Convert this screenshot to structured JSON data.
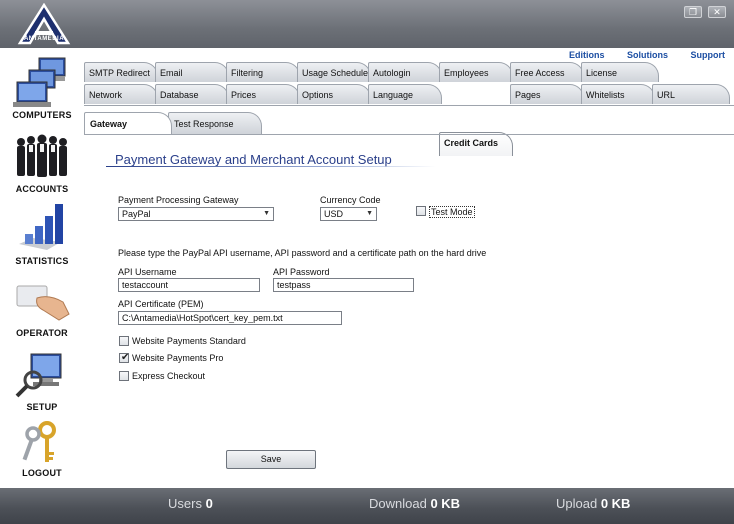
{
  "app": {
    "logo_text": "ANTAMEDIA",
    "restore_label": "❐",
    "close_label": "✕"
  },
  "top_links": [
    "Editions",
    "Solutions",
    "Support"
  ],
  "sidebar": {
    "items": [
      {
        "label": "COMPUTERS",
        "icon": "computers-icon"
      },
      {
        "label": "ACCOUNTS",
        "icon": "accounts-icon"
      },
      {
        "label": "STATISTICS",
        "icon": "statistics-icon"
      },
      {
        "label": "OPERATOR",
        "icon": "operator-icon"
      },
      {
        "label": "SETUP",
        "icon": "setup-icon"
      },
      {
        "label": "LOGOUT",
        "icon": "logout-icon"
      }
    ]
  },
  "tabs_row1": [
    "SMTP Redirect",
    "Email",
    "Filtering",
    "Usage Schedule",
    "Autologin",
    "Employees",
    "Free Access",
    "License"
  ],
  "tabs_row2": [
    "Network",
    "Database",
    "Prices",
    "Options",
    "Language",
    "Credit Cards",
    "Pages",
    "Whitelists",
    "URL"
  ],
  "active_tab": "Credit Cards",
  "subtabs": [
    "Gateway",
    "Test Response"
  ],
  "active_subtab": "Gateway",
  "form": {
    "title": "Payment Gateway and Merchant Account Setup",
    "gateway_label": "Payment Processing Gateway",
    "gateway_value": "PayPal",
    "currency_label": "Currency Code",
    "currency_value": "USD",
    "test_mode_label": "Test Mode",
    "test_mode_checked": false,
    "instructions": "Please type the PayPal API username, API password and a certificate path on the hard drive",
    "api_username_label": "API Username",
    "api_username_value": "testaccount",
    "api_password_label": "API Password",
    "api_password_value": "testpass",
    "api_cert_label": "API Certificate (PEM)",
    "api_cert_value": "C:\\Antamedia\\HotSpot\\cert_key_pem.txt",
    "options": [
      {
        "label": "Website Payments Standard",
        "checked": false
      },
      {
        "label": "Website Payments Pro",
        "checked": true
      },
      {
        "label": "Express Checkout",
        "checked": false
      }
    ],
    "save_label": "Save"
  },
  "status": {
    "users_label": "Users",
    "users_value": "0",
    "download_label": "Download",
    "download_value": "0 KB",
    "upload_label": "Upload",
    "upload_value": "0 KB"
  },
  "colors": {
    "accent": "#2a3f8a",
    "link": "#1d4fa3"
  }
}
